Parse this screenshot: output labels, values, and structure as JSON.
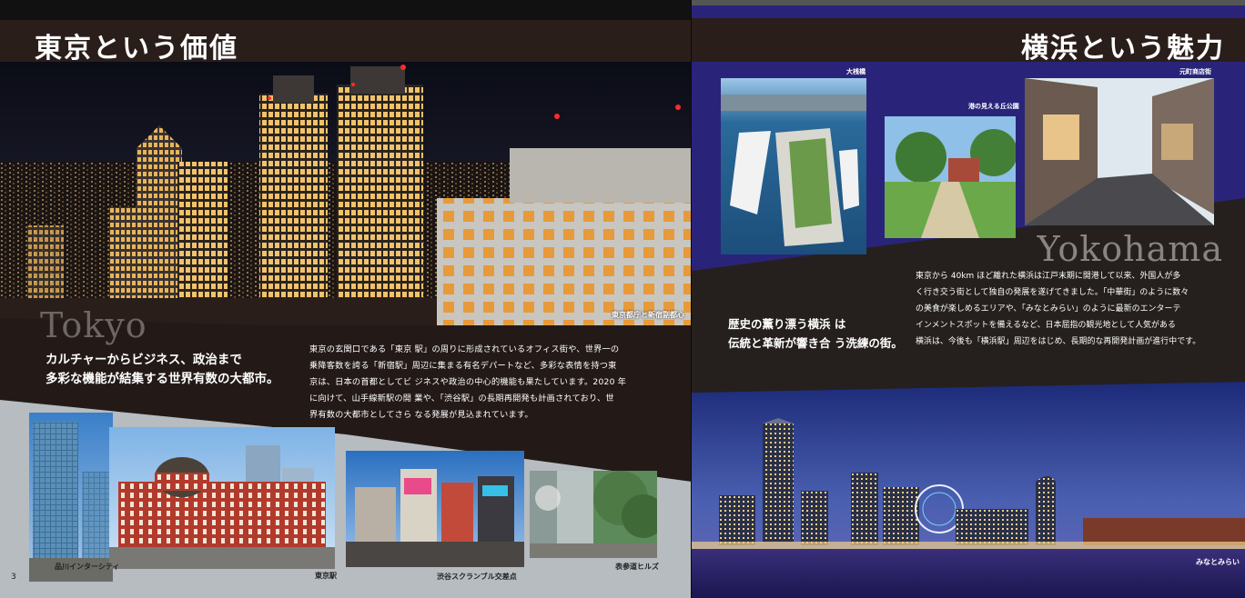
{
  "left_page": {
    "title": "東京という価値",
    "hero_caption": "東京都庁と新宿副都心",
    "city_word": "Tokyo",
    "tagline": [
      "カルチャーからビジネス、政治まで",
      "多彩な機能が結集する世界有数の大都市。"
    ],
    "body": [
      "東京の玄関口である「東京 駅」の周りに形成されているオフィス街や、世界一の",
      "乗降客数を誇る「新宿駅」周辺に集まる有名デパートなど、多彩な表情を持つ東",
      "京は、日本の首都としてビ ジネスや政治の中心的機能も果たしています。2020 年",
      "に向けて、山手線新駅の開 業や、「渋谷駅」の長期再開発も計画されており、世",
      "界有数の大都市としてさら なる発展が見込まれています。"
    ],
    "gallery": [
      {
        "caption": "品川インターシティ"
      },
      {
        "caption": "東京駅"
      },
      {
        "caption": "渋谷スクランブル交差点"
      },
      {
        "caption": "表参道ヒルズ"
      }
    ],
    "page_number": "3"
  },
  "right_page": {
    "title": "横浜という魅力",
    "photos": [
      {
        "caption": "大桟橋"
      },
      {
        "caption": "港の見える丘公園"
      },
      {
        "caption": "元町商店街"
      }
    ],
    "city_word": "Yokohama",
    "tagline": [
      "歴史の薫り漂う横浜 は",
      "伝統と革新が響き合 う洗練の街。"
    ],
    "body": [
      "東京から 40km ほど離れた横浜は江戸末期に開港して以来、外国人が多",
      "く行き交う街として独自の発展を遂げてきました。「中華街」のように数々",
      "の美食が楽しめるエリアや、「みなとみらい」のように最新のエンターテ",
      "インメントスポットを備えるなど、日本屈指の観光地として人気がある",
      "横浜は、今後も「横浜駅」周辺をはじめ、長期的な再開発計画が進行中です。"
    ],
    "night_caption": "みなとみらい"
  },
  "colors": {
    "accent_blue": "#29247a",
    "dark_brown": "#231a18"
  }
}
